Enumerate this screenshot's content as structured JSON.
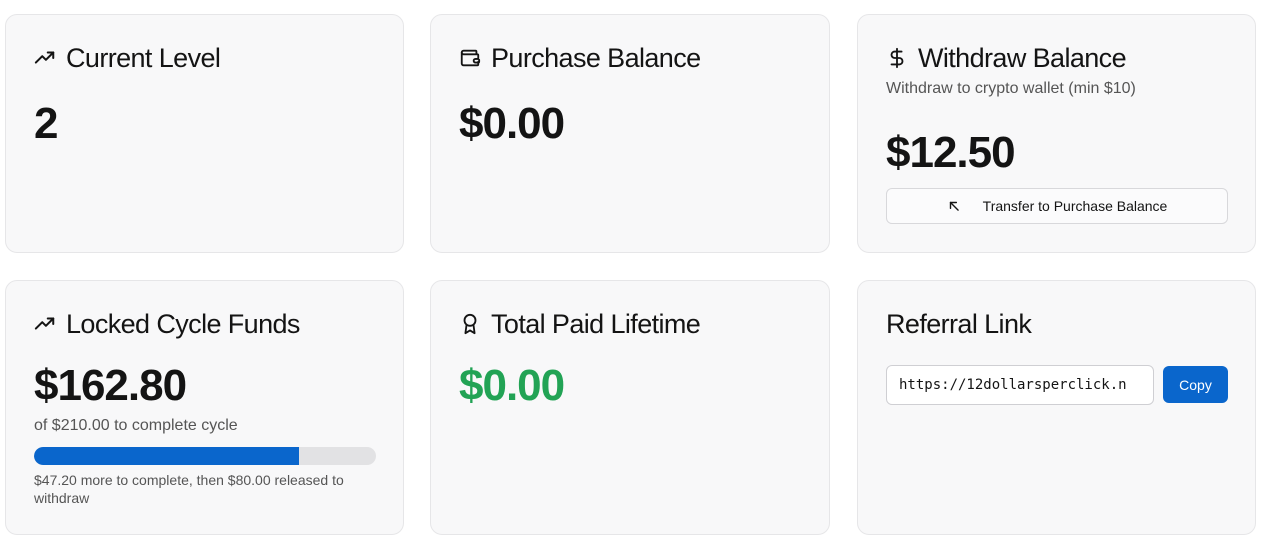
{
  "cards": {
    "current_level": {
      "title": "Current Level",
      "icon": "trending-up-icon",
      "value": "2"
    },
    "purchase_balance": {
      "title": "Purchase Balance",
      "icon": "wallet-icon",
      "value": "$0.00"
    },
    "withdraw_balance": {
      "title": "Withdraw Balance",
      "icon": "dollar-icon",
      "subtitle": "Withdraw to crypto wallet (min $10)",
      "value": "$12.50",
      "button_label": "Transfer to Purchase Balance",
      "button_icon": "arrow-up-left-icon"
    },
    "locked_cycle_funds": {
      "title": "Locked Cycle Funds",
      "icon": "trending-up-icon",
      "value": "$162.80",
      "subtitle": "of $210.00 to complete cycle",
      "progress_percent": 77.5,
      "note": "$47.20 more to complete, then $80.00 released to withdraw"
    },
    "total_paid_lifetime": {
      "title": "Total Paid Lifetime",
      "icon": "award-icon",
      "value": "$0.00",
      "value_color": "#22a355"
    },
    "referral_link": {
      "title": "Referral Link",
      "input_value": "https://12dollarsperclick.n",
      "copy_label": "Copy"
    }
  },
  "colors": {
    "accent": "#0a66cc",
    "success": "#22a355",
    "card_background": "#f8f8f9"
  }
}
